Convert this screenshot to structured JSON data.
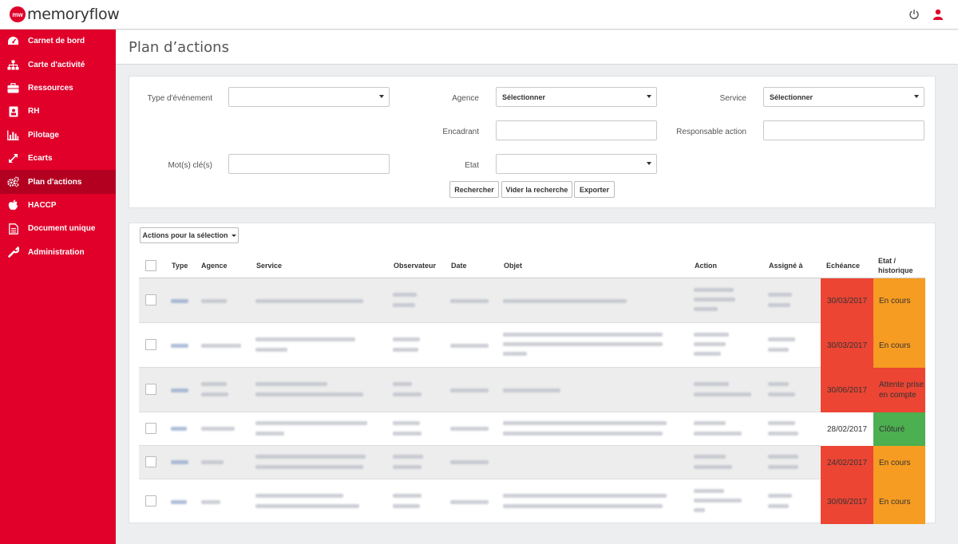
{
  "app": {
    "logo_badge": "mw",
    "logo_text": "memoryflow"
  },
  "header_icons": [
    "power-icon",
    "user-icon"
  ],
  "sidebar": {
    "items": [
      {
        "label": "Carnet de bord",
        "icon": "dashboard-icon"
      },
      {
        "label": "Carte d'activité",
        "icon": "sitemap-icon"
      },
      {
        "label": "Ressources",
        "icon": "briefcase-icon"
      },
      {
        "label": "RH",
        "icon": "id-badge-icon"
      },
      {
        "label": "Pilotage",
        "icon": "bar-chart-icon"
      },
      {
        "label": "Ecarts",
        "icon": "expand-arrows-icon"
      },
      {
        "label": "Plan d'actions",
        "icon": "cogs-icon",
        "active": true
      },
      {
        "label": "HACCP",
        "icon": "apple-icon"
      },
      {
        "label": "Document unique",
        "icon": "document-icon"
      },
      {
        "label": "Administration",
        "icon": "wrench-icon"
      }
    ]
  },
  "page": {
    "title": "Plan d’actions"
  },
  "search": {
    "type_label": "Type d'événement",
    "type_value": "",
    "agence_label": "Agence",
    "agence_value": "Sélectionner",
    "service_label": "Service",
    "service_value": "Sélectionner",
    "encadrant_label": "Encadrant",
    "responsable_label": "Responsable action",
    "motcle_label": "Mot(s) clé(s)",
    "etat_label": "Etat",
    "etat_value": "",
    "btn_search": "Rechercher",
    "btn_clear": "Vider la recherche",
    "btn_export": "Exporter"
  },
  "results": {
    "selection_button": "Actions pour la sélection",
    "columns": {
      "type": "Type",
      "agence": "Agence",
      "service": "Service",
      "observateur": "Observateur",
      "date": "Date",
      "objet": "Objet",
      "action": "Action",
      "assigne": "Assigné à",
      "echeance": "Echéance",
      "etat": "Etat / historique"
    },
    "rows": [
      {
        "due": "30/03/2017",
        "state": "En cours"
      },
      {
        "due": "30/03/2017",
        "state": "En cours"
      },
      {
        "due": "30/06/2017",
        "state": "Attente prise en compte"
      },
      {
        "due": "28/02/2017",
        "state": "Clôturé"
      },
      {
        "due": "24/02/2017",
        "state": "En cours"
      },
      {
        "due": "30/09/2017",
        "state": "En cours"
      }
    ]
  },
  "colors": {
    "brand": "#e0002a",
    "brand_active": "#b30021",
    "overdue": "#ec4534",
    "in_progress": "#f79c22",
    "closed": "#4caf50"
  }
}
